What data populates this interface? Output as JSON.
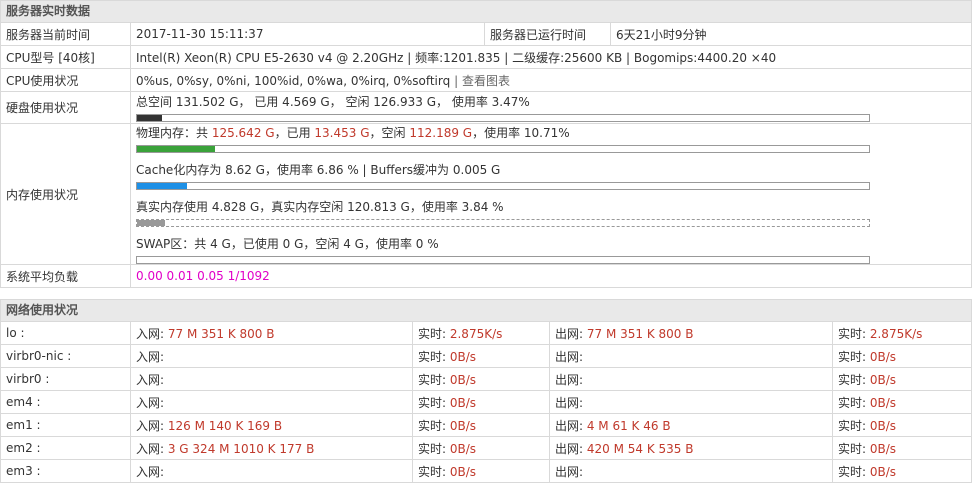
{
  "server": {
    "section_title": "服务器实时数据",
    "time_label": "服务器当前时间",
    "time_value": "2017-11-30 15:11:37",
    "uptime_label": "服务器已运行时间",
    "uptime_value": "6天21小时9分钟",
    "cpu_model_label": "CPU型号 [40核]",
    "cpu_model_value": "Intel(R) Xeon(R) CPU E5-2630 v4 @ 2.20GHz | 频率:1201.835 | 二级缓存:25600 KB | Bogomips:4400.20 ×40",
    "cpu_usage_label": "CPU使用状况",
    "cpu_usage_value": "0%us, 0%sy, 0%ni, 100%id, 0%wa, 0%irq, 0%softirq",
    "cpu_sep": "|",
    "cpu_chart_link": "查看图表",
    "disk_label": "硬盘使用状况",
    "disk_text": "总空间 131.502 G， 已用 4.569 G， 空闲 126.933 G， 使用率 3.47%",
    "disk_percent": 3.47,
    "disk_color": "#333333",
    "mem_label": "内存使用状况",
    "mem_phys_prefix": "物理内存：共 ",
    "mem_phys_total": "125.642 G",
    "mem_phys_used_label": "，已用 ",
    "mem_phys_used": "13.453 G",
    "mem_phys_free_label": "，空闲 ",
    "mem_phys_free": "112.189 G",
    "mem_phys_rate": "，使用率 10.71%",
    "mem_phys_percent": 10.71,
    "mem_phys_color": "#3aa23a",
    "mem_cache_text": "Cache化内存为 8.62 G，使用率 6.86 % | Buffers缓冲为 0.005 G",
    "mem_cache_percent": 6.86,
    "mem_cache_color": "#1e90e6",
    "mem_real_text": "真实内存使用 4.828 G，真实内存空闲 120.813 G，使用率 3.84 %",
    "mem_real_percent": 3.84,
    "mem_real_color": "#999999",
    "mem_swap_text": "SWAP区：共 4 G，已使用 0 G，空闲 4 G，使用率 0 %",
    "mem_swap_percent": 0,
    "load_label": "系统平均负载",
    "load_value": "0.00 0.01 0.05 1/1092"
  },
  "network": {
    "section_title": "网络使用状况",
    "rows": [
      {
        "iface": "lo :",
        "in_label": "入网: ",
        "in_value": "77 M 351 K 800 B",
        "rt1_label": "实时: ",
        "rt1_value": "2.875K/s",
        "out_label": "出网: ",
        "out_value": "77 M 351 K 800 B",
        "rt2_label": "实时: ",
        "rt2_value": "2.875K/s"
      },
      {
        "iface": "virbr0-nic :",
        "in_label": "入网: ",
        "in_value": "",
        "rt1_label": "实时: ",
        "rt1_value": "0B/s",
        "out_label": "出网: ",
        "out_value": "",
        "rt2_label": "实时: ",
        "rt2_value": "0B/s"
      },
      {
        "iface": "virbr0 :",
        "in_label": "入网: ",
        "in_value": "",
        "rt1_label": "实时: ",
        "rt1_value": "0B/s",
        "out_label": "出网: ",
        "out_value": "",
        "rt2_label": "实时: ",
        "rt2_value": "0B/s"
      },
      {
        "iface": "em4 :",
        "in_label": "入网: ",
        "in_value": "",
        "rt1_label": "实时: ",
        "rt1_value": "0B/s",
        "out_label": "出网: ",
        "out_value": "",
        "rt2_label": "实时: ",
        "rt2_value": "0B/s"
      },
      {
        "iface": "em1 :",
        "in_label": "入网: ",
        "in_value": "126 M 140 K 169 B",
        "rt1_label": "实时: ",
        "rt1_value": "0B/s",
        "out_label": "出网: ",
        "out_value": "4 M 61 K 46 B",
        "rt2_label": "实时: ",
        "rt2_value": "0B/s"
      },
      {
        "iface": "em2 :",
        "in_label": "入网: ",
        "in_value": "3 G 324 M 1010 K 177 B",
        "rt1_label": "实时: ",
        "rt1_value": "0B/s",
        "out_label": "出网: ",
        "out_value": "420 M 54 K 535 B",
        "rt2_label": "实时: ",
        "rt2_value": "0B/s"
      },
      {
        "iface": "em3 :",
        "in_label": "入网: ",
        "in_value": "",
        "rt1_label": "实时: ",
        "rt1_value": "0B/s",
        "out_label": "出网: ",
        "out_value": "",
        "rt2_label": "实时: ",
        "rt2_value": "0B/s"
      }
    ]
  }
}
